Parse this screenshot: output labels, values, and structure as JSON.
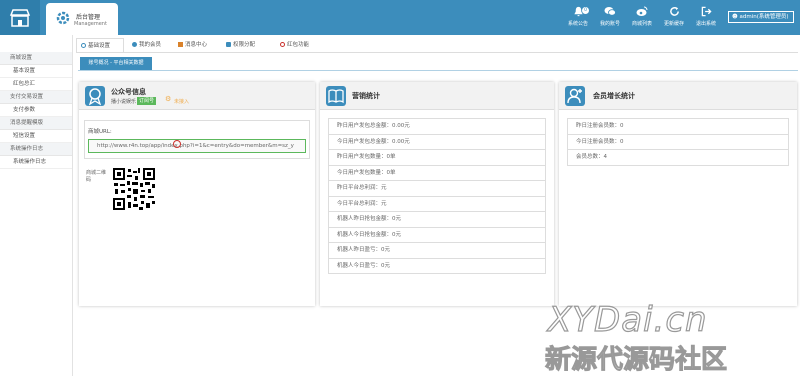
{
  "header": {
    "mgmt_title": "后台管理",
    "mgmt_sub": "Management",
    "nav": [
      {
        "label": "系统公告",
        "icon": "bell-icon",
        "badge": "0"
      },
      {
        "label": "我的账号",
        "icon": "chat-icon",
        "badge": ""
      },
      {
        "label": "商城列表",
        "icon": "weibo-icon",
        "badge": ""
      },
      {
        "label": "更新缓存",
        "icon": "refresh-icon",
        "badge": ""
      },
      {
        "label": "退出系统",
        "icon": "exit-icon",
        "badge": ""
      }
    ],
    "admin": "admin(系统管理员)"
  },
  "sidebar": {
    "groups": [
      {
        "label": "商城设置",
        "items": [
          "基本设置",
          "红包总汇"
        ]
      },
      {
        "label": "支付交易设置",
        "items": [
          "支付参数"
        ]
      },
      {
        "label": "消息提醒模版",
        "items": [
          "短信设置"
        ]
      },
      {
        "label": "系统操作日志",
        "items": [
          "系统操作日志"
        ]
      }
    ]
  },
  "tabs": [
    "基础设置",
    "我的会员",
    "消息中心",
    "权限分配",
    "红包功能"
  ],
  "subtab": "账号概况 - 平台相关数据",
  "panels": {
    "account": {
      "title": "公众号信息",
      "name": "播小说娱乐",
      "badge": "订阅号",
      "status": "未接入",
      "url_label": "商城URL:",
      "url": "http://www.r4n.top/app/index.php?i=1&c=entry&do=member&m=sz_y",
      "qr_label": "商城二维码"
    },
    "marketing": {
      "title": "营销统计",
      "rows": [
        "昨日用户发包总金额：0.00元",
        "今日用户发包总金额：0.00元",
        "昨日用户发包数量：0单",
        "今日用户发包数量：0单",
        "昨日平台总利润：元",
        "今日平台总利润：元",
        "机器人昨日抢包金额：0元",
        "机器人今日抢包金额：0元",
        "机器人昨日盈亏：0元",
        "机器人今日盈亏：0元"
      ]
    },
    "member": {
      "title": "会员增长统计",
      "rows": [
        "昨日注册会员数：0",
        "今日注册会员数：0",
        "会员总数：4"
      ]
    }
  },
  "watermark": {
    "line1": "XYDai.cn",
    "line2": "新源代源码社区"
  },
  "colors": {
    "primary": "#3c8dbc",
    "badge_green": "#5cb85c",
    "status_orange": "#f0ad4e"
  }
}
